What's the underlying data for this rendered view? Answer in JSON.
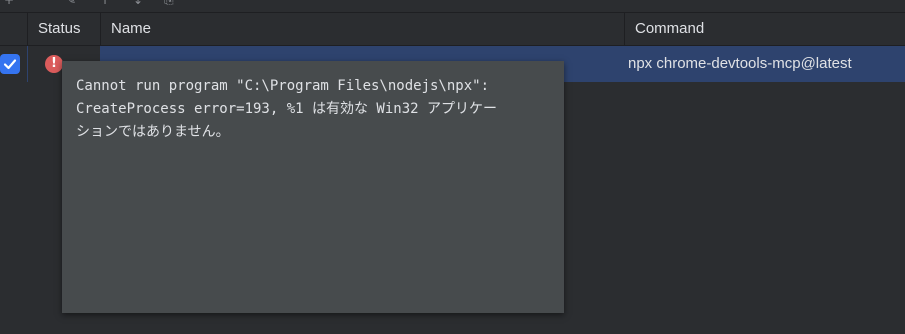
{
  "toolbar": {
    "icons": [
      "add-icon",
      "edit-icon",
      "move-up-icon",
      "move-down-icon",
      "copy-icon"
    ]
  },
  "table": {
    "columns": [
      "Status",
      "Name",
      "Command"
    ],
    "rows": [
      {
        "checked": true,
        "status": "error",
        "name": "",
        "command": "npx chrome-devtools-mcp@latest"
      }
    ]
  },
  "tooltip": {
    "text": "Cannot run program \"C:\\Program Files\\nodejs\\npx\":\nCreateProcess error=193, %1 は有効な Win32 アプリケー\nションではありません。"
  },
  "colors": {
    "background": "#2b2d30",
    "selection": "#2e436e",
    "checkbox": "#3574f0",
    "error": "#db5c5c",
    "tooltip_bg": "#474b4d"
  }
}
